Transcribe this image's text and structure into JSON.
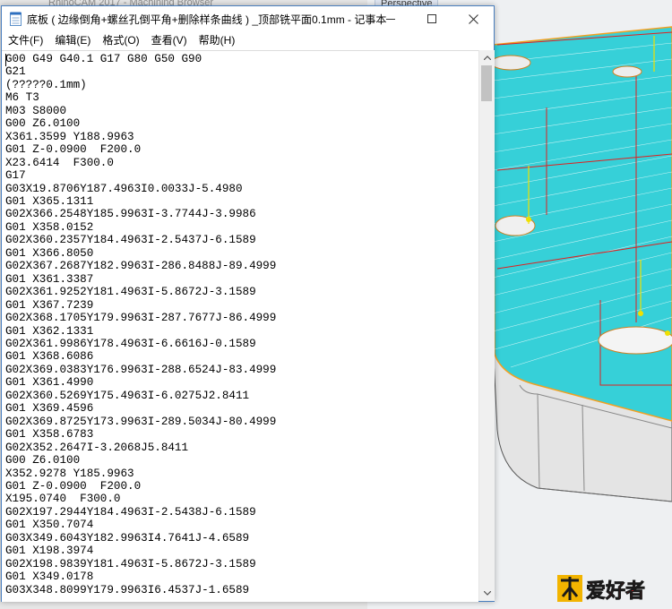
{
  "background_app": {
    "title": "RhinoCAM 2017 - Machining Browser",
    "viewport_label": "Perspective"
  },
  "window": {
    "title": "底板 ( 边缘倒角+螺丝孔倒平角+删除样条曲线 ) _顶部铣平面0.1mm - 记事本",
    "icon": "notepad-icon"
  },
  "menu": [
    "文件(F)",
    "编辑(E)",
    "格式(O)",
    "查看(V)",
    "帮助(H)"
  ],
  "code_lines": [
    "G00 G49 G40.1 G17 G80 G50 G90",
    "G21",
    "(?????0.1mm)",
    "M6 T3",
    "M03 S8000",
    "G00 Z6.0100",
    "X361.3599 Y188.9963",
    "G01 Z-0.0900  F200.0",
    "X23.6414  F300.0",
    "G17",
    "G03X19.8706Y187.4963I0.0033J-5.4980",
    "G01 X365.1311",
    "G02X366.2548Y185.9963I-3.7744J-3.9986",
    "G01 X358.0152",
    "G02X360.2357Y184.4963I-2.5437J-6.1589",
    "G01 X366.8050",
    "G02X367.2687Y182.9963I-286.8488J-89.4999",
    "G01 X361.3387",
    "G02X361.9252Y181.4963I-5.8672J-3.1589",
    "G01 X367.7239",
    "G02X368.1705Y179.9963I-287.7677J-86.4999",
    "G01 X362.1331",
    "G02X361.9986Y178.4963I-6.6616J-0.1589",
    "G01 X368.6086",
    "G02X369.0383Y176.9963I-288.6524J-83.4999",
    "G01 X361.4990",
    "G02X360.5269Y175.4963I-6.0275J2.8411",
    "G01 X369.4596",
    "G02X369.8725Y173.9963I-289.5034J-80.4999",
    "G01 X358.6783",
    "G02X352.2647I-3.2068J5.8411",
    "G00 Z6.0100",
    "X352.9278 Y185.9963",
    "G01 Z-0.0900  F200.0",
    "X195.0740  F300.0",
    "G02X197.2944Y184.4963I-2.5438J-6.1589",
    "G01 X350.7074",
    "G03X349.6043Y182.9963I4.7641J-4.6589",
    "G01 X198.3974",
    "G02X198.9839Y181.4963I-5.8672J-3.1589",
    "G01 X349.0178",
    "G03X348.8099Y179.9963I6.4537J-1.6589"
  ],
  "watermark_text": "木工爱好者",
  "colors": {
    "window_border": "#4a7fbf",
    "viewport_surface": "#36d0d8",
    "toolpath_red": "#e02020",
    "toolpath_orange": "#f2a020"
  }
}
